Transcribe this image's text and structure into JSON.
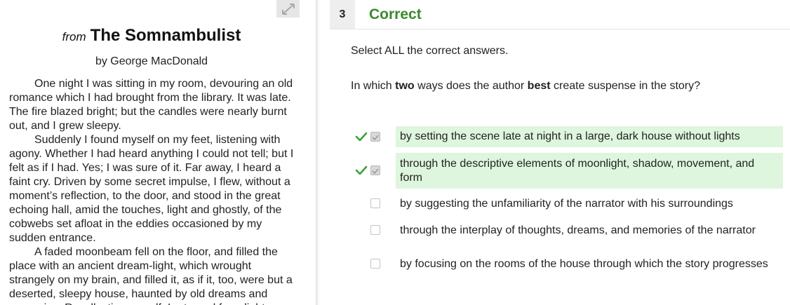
{
  "passage": {
    "title_prefix": "from",
    "title": "The Somnambulist",
    "author": "by George MacDonald",
    "paragraphs": [
      "One night I was sitting in my room, devouring an old romance which I had brought from the library. It was late. The fire blazed bright; but the candles were nearly burnt out, and I grew sleepy.",
      "Suddenly I found myself on my feet, listening with agony. Whether I had heard anything I could not tell; but I felt as if I had. Yes; I was sure of it. Far away, I heard a faint cry. Driven by some secret impulse, I flew, without a moment’s reflection, to the door, and stood in the great echoing hall, amid the touches, light and ghostly, of the cobwebs set afloat in the eddies occasioned by my sudden entrance.",
      "A faded moonbeam fell on the floor, and filled the place with an ancient dream-light, which wrought strangely on my brain, and filled it, as if it, too, were but a deserted, sleepy house, haunted by old dreams and memories. Recollecting myself, I returned for a light."
    ],
    "expand_icon": "expand-arrows-icon"
  },
  "question": {
    "number": "3",
    "status": "Correct",
    "instruction": "Select ALL the correct answers.",
    "prompt_parts": [
      "In which ",
      "two",
      " ways does the author ",
      "best",
      " create suspense in the story?"
    ],
    "answers": [
      {
        "text": "by setting the scene late at night in a large, dark house without lights",
        "checked": true,
        "correct": true
      },
      {
        "text": "through the descriptive elements of moonlight, shadow, movement, and form",
        "checked": true,
        "correct": true
      },
      {
        "text": "by suggesting the unfamiliarity of the narrator with his surroundings",
        "checked": false,
        "correct": false
      },
      {
        "text": "through the interplay of thoughts, dreams, and memories of the narrator",
        "checked": false,
        "correct": false
      },
      {
        "text": "by focusing on the rooms of the house through which the story progresses",
        "checked": false,
        "correct": false
      }
    ]
  },
  "colors": {
    "correct_text": "#3a8a2c",
    "correct_highlight": "#ddf6dd",
    "checkmark": "#3aa33a"
  }
}
